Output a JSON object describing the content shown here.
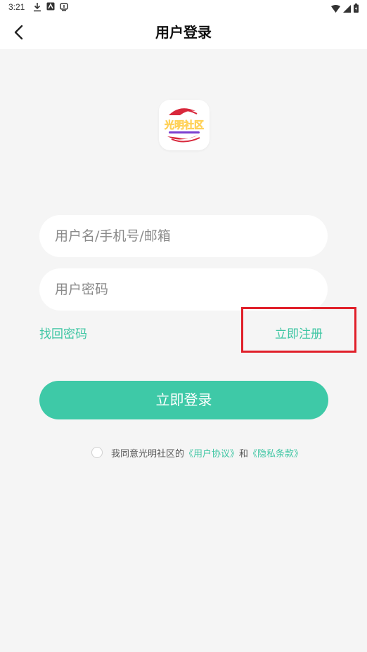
{
  "status_bar": {
    "time": "3:21",
    "icons": [
      "download-icon",
      "app-icon",
      "notification-icon",
      "wifi-icon",
      "signal-icon",
      "battery-icon"
    ]
  },
  "header": {
    "title": "用户登录",
    "back_icon": "chevron-left-icon"
  },
  "logo": {
    "text": "光明社区"
  },
  "form": {
    "username_placeholder": "用户名/手机号/邮箱",
    "password_placeholder": "用户密码",
    "forgot_password": "找回密码",
    "register": "立即注册",
    "login_button": "立即登录"
  },
  "agreement": {
    "prefix": "我同意光明社区的",
    "user_agreement": "《用户协议》",
    "and": "和",
    "privacy_policy": "《隐私条款》"
  },
  "colors": {
    "accent": "#3ec9a7",
    "highlight": "#e0202a",
    "background": "#f5f5f5"
  }
}
